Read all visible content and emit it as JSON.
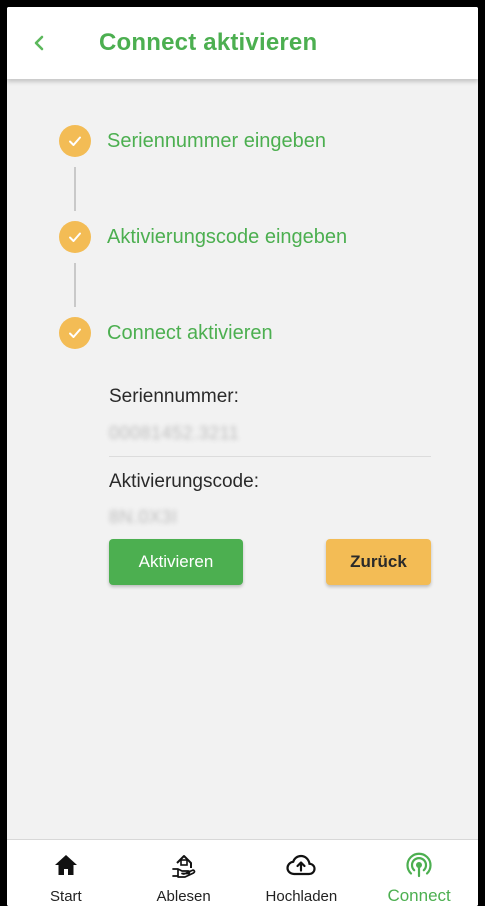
{
  "header": {
    "title": "Connect aktivieren",
    "back_icon": "chevron-left-icon"
  },
  "steps": [
    {
      "label": "Seriennummer eingeben",
      "status": "done"
    },
    {
      "label": "Aktivierungscode eingeben",
      "status": "done"
    },
    {
      "label": "Connect aktivieren",
      "status": "done"
    }
  ],
  "form": {
    "serial_label": "Seriennummer:",
    "serial_value": "00081452.3211",
    "code_label": "Aktivierungscode:",
    "code_value": "8N.0X3I"
  },
  "buttons": {
    "activate_label": "Aktivieren",
    "back_label": "Zurück"
  },
  "nav": {
    "items": [
      {
        "label": "Start",
        "icon": "home-icon"
      },
      {
        "label": "Ablesen",
        "icon": "meter-reading-icon"
      },
      {
        "label": "Hochladen",
        "icon": "cloud-upload-icon"
      },
      {
        "label": "Connect",
        "icon": "connect-signal-icon",
        "active": true
      }
    ]
  },
  "colors": {
    "accent_green": "#4caf50",
    "accent_orange": "#f3bc55",
    "background": "#f2f2f2"
  }
}
